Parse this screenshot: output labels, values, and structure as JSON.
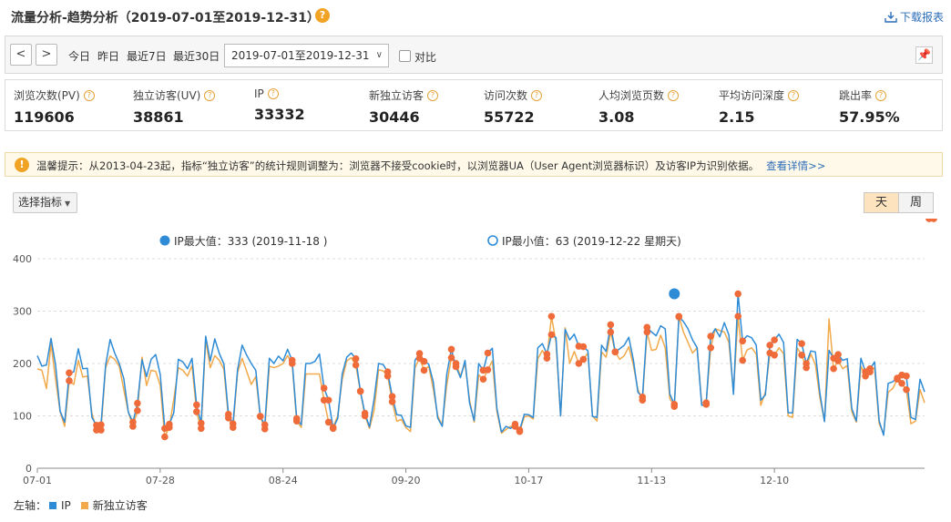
{
  "header": {
    "title": "流量分析-趋势分析（2019-07-01至2019-12-31）",
    "help_icon": "?",
    "download_label": "下载报表",
    "download_icon": "download-icon"
  },
  "toolbar": {
    "prev": "<",
    "next": ">",
    "quick_ranges": [
      "今日",
      "昨日",
      "最近7日",
      "最近30日"
    ],
    "date_range": "2019-07-01至2019-12-31",
    "compare_label": "对比",
    "compare_checked": false
  },
  "metrics": [
    {
      "label": "浏览次数(PV)",
      "value": "119606"
    },
    {
      "label": "独立访客(UV)",
      "value": "38861"
    },
    {
      "label": "IP",
      "value": "33332"
    },
    {
      "label": "新独立访客",
      "value": "30446"
    },
    {
      "label": "访问次数",
      "value": "55722"
    },
    {
      "label": "人均浏览页数",
      "value": "3.08"
    },
    {
      "label": "平均访问深度",
      "value": "2.15"
    },
    {
      "label": "跳出率",
      "value": "57.95%"
    }
  ],
  "notice": {
    "icon": "!",
    "text": "温馨提示：从2013-04-23起，指标“独立访客”的统计规则调整为：浏览器不接受cookie时，以浏览器UA（User Agent浏览器标识）及访客IP为识别依据。",
    "link": "查看详情>>"
  },
  "controls": {
    "metric_select": "选择指标",
    "granularity": [
      "天",
      "周"
    ],
    "granularity_selected": "天"
  },
  "chart_data": {
    "type": "line",
    "x_start": "2019-07-01",
    "x_end": "2019-12-31",
    "x_ticks": [
      "07-01",
      "07-28",
      "08-24",
      "09-20",
      "10-17",
      "11-13",
      "12-10"
    ],
    "ylim": [
      0,
      400
    ],
    "y_ticks": [
      "0",
      "100",
      "200",
      "300",
      "400"
    ],
    "grid_y": true,
    "legend_top": [
      {
        "label": "IP最大值：333 (2019-11-18 )",
        "marker": "filled-circle"
      },
      {
        "label": "IP最小值：63 (2019-12-22 星期天)",
        "marker": "hollow-circle"
      }
    ],
    "max_point": {
      "date": "2019-11-18",
      "value": 333
    },
    "axis_caption": "左轴：",
    "series": [
      {
        "name": "IP",
        "color": "#2e8bd6",
        "values": [
          215,
          195,
          197,
          248,
          197,
          109,
          88,
          182,
          184,
          228,
          190,
          191,
          97,
          82,
          83,
          196,
          246,
          220,
          200,
          171,
          107,
          88,
          124,
          207,
          175,
          208,
          217,
          179,
          76,
          84,
          106,
          208,
          203,
          190,
          210,
          121,
          86,
          252,
          205,
          247,
          219,
          199,
          103,
          85,
          188,
          235,
          216,
          200,
          187,
          99,
          83,
          210,
          200,
          214,
          205,
          227,
          206,
          95,
          83,
          200,
          200,
          204,
          218,
          153,
          130,
          76,
          95,
          180,
          212,
          220,
          209,
          147,
          105,
          79,
          131,
          200,
          198,
          184,
          137,
          102,
          101,
          81,
          78,
          206,
          219,
          204,
          199,
          165,
          96,
          80,
          180,
          227,
          194,
          173,
          206,
          124,
          91,
          200,
          187,
          220,
          229,
          114,
          69,
          80,
          76,
          84,
          73,
          103,
          102,
          97,
          230,
          238,
          218,
          255,
          249,
          100,
          265,
          245,
          256,
          233,
          232,
          224,
          99,
          97,
          235,
          223,
          274,
          222,
          228,
          235,
          250,
          207,
          145,
          136,
          269,
          260,
          253,
          272,
          266,
          142,
          122,
          289,
          280,
          266,
          245,
          230,
          120,
          122,
          252,
          266,
          251,
          278,
          254,
          141,
          333,
          243,
          253,
          249,
          235,
          130,
          140,
          235,
          245,
          256,
          240,
          106,
          106,
          246,
          238,
          200,
          224,
          222,
          143,
          89,
          225,
          210,
          217,
          206,
          209,
          114,
          90,
          210,
          184,
          190,
          203,
          91,
          63,
          162,
          165,
          172,
          178,
          176,
          97,
          93,
          170,
          146
        ]
      },
      {
        "name": "新独立访客",
        "color": "#f1a94a",
        "values": [
          190,
          187,
          152,
          238,
          170,
          108,
          80,
          167,
          160,
          206,
          174,
          176,
          105,
          73,
          73,
          192,
          214,
          208,
          195,
          150,
          107,
          80,
          110,
          212,
          158,
          187,
          185,
          158,
          60,
          78,
          132,
          192,
          187,
          176,
          196,
          108,
          76,
          245,
          192,
          215,
          206,
          189,
          96,
          78,
          183,
          210,
          185,
          160,
          175,
          99,
          75,
          195,
          192,
          195,
          200,
          215,
          200,
          90,
          78,
          180,
          180,
          180,
          180,
          130,
          88,
          78,
          100,
          170,
          205,
          211,
          197,
          147,
          100,
          76,
          110,
          188,
          186,
          176,
          127,
          90,
          93,
          78,
          70,
          192,
          210,
          187,
          195,
          152,
          100,
          82,
          160,
          211,
          200,
          176,
          200,
          130,
          88,
          178,
          170,
          188,
          205,
          108,
          67,
          74,
          80,
          80,
          70,
          98,
          100,
          94,
          209,
          225,
          210,
          290,
          240,
          100,
          268,
          200,
          223,
          200,
          208,
          220,
          100,
          90,
          222,
          212,
          260,
          222,
          208,
          215,
          232,
          197,
          150,
          130,
          260,
          225,
          227,
          254,
          230,
          133,
          118,
          290,
          260,
          240,
          220,
          230,
          125,
          125,
          230,
          266,
          263,
          260,
          240,
          145,
          290,
          206,
          226,
          230,
          218,
          120,
          145,
          220,
          216,
          230,
          219,
          100,
          97,
          230,
          216,
          192,
          218,
          198,
          134,
          90,
          285,
          190,
          205,
          190,
          196,
          108,
          88,
          195,
          176,
          184,
          192,
          85,
          66,
          145,
          152,
          170,
          162,
          150,
          85,
          90,
          150,
          125
        ]
      }
    ],
    "markers": {
      "color": "#f06b3a",
      "indices": [
        7,
        13,
        14,
        21,
        22,
        28,
        29,
        35,
        36,
        42,
        43,
        49,
        50,
        56,
        57,
        63,
        64,
        65,
        70,
        71,
        72,
        77,
        78,
        84,
        85,
        91,
        92,
        98,
        99,
        105,
        106,
        112,
        113,
        119,
        120,
        126,
        127,
        133,
        134,
        140,
        141,
        147,
        148,
        154,
        155,
        161,
        162,
        168,
        169,
        175,
        176,
        182,
        183,
        189,
        190,
        191,
        196,
        197
      ]
    }
  }
}
